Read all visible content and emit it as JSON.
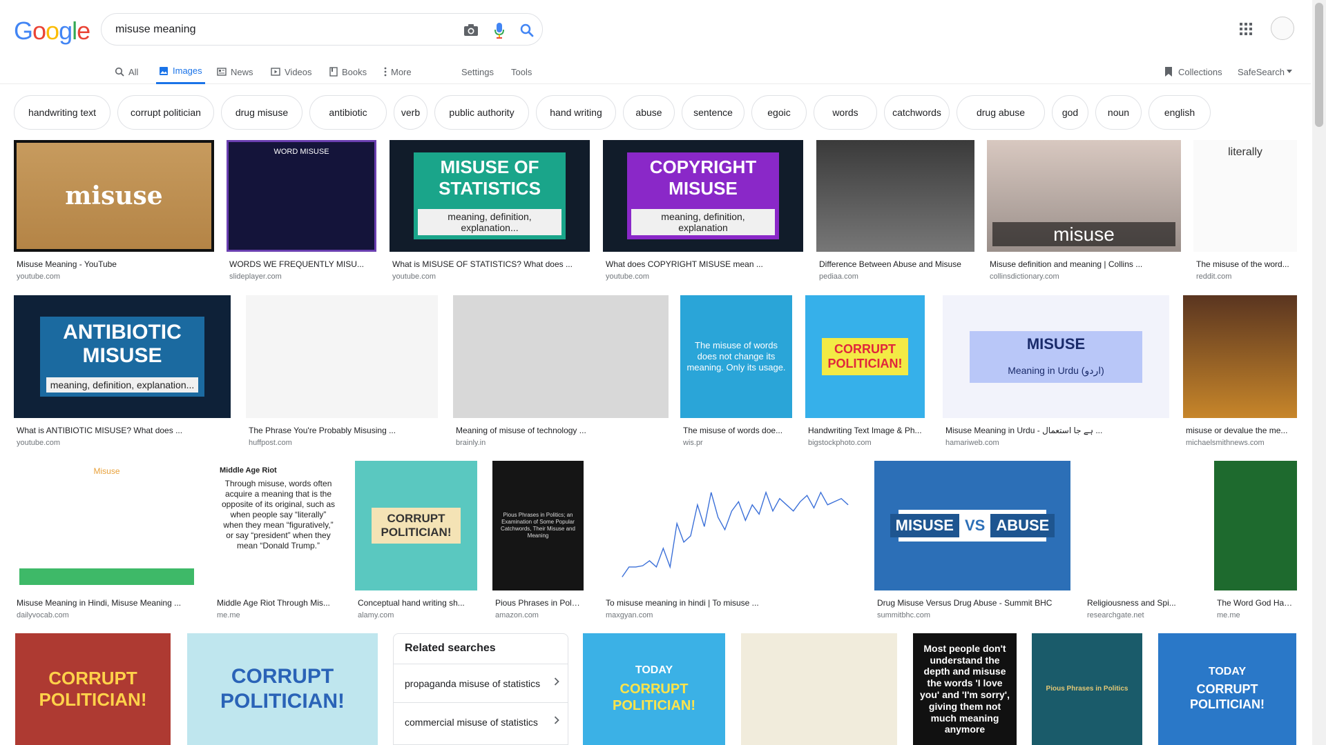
{
  "logo": "Google",
  "search": {
    "query": "misuse meaning"
  },
  "nav": {
    "all": "All",
    "images": "Images",
    "news": "News",
    "videos": "Videos",
    "books": "Books",
    "more": "More",
    "settings": "Settings",
    "tools": "Tools",
    "collections": "Collections",
    "safesearch": "SafeSearch"
  },
  "chips": [
    "handwriting text",
    "corrupt politician",
    "drug misuse",
    "antibiotic",
    "verb",
    "public authority",
    "hand writing",
    "abuse",
    "sentence",
    "egoic",
    "words",
    "catchwords",
    "drug abuse",
    "god",
    "noun",
    "english"
  ],
  "results": [
    {
      "caption": "Misuse Meaning - YouTube",
      "source": "youtube.com",
      "thumb_text": "misuse"
    },
    {
      "caption": "WORDS WE FREQUENTLY MISU...",
      "source": "slideplayer.com",
      "thumb_text": "WORD MISUSE"
    },
    {
      "caption": "What is MISUSE OF STATISTICS? What does ...",
      "source": "youtube.com",
      "thumb_text": "MISUSE OF STATISTICS",
      "thumb_sub": "meaning, definition, explanation..."
    },
    {
      "caption": "What does COPYRIGHT MISUSE mean ...",
      "source": "youtube.com",
      "thumb_text": "COPYRIGHT MISUSE",
      "thumb_sub": "meaning, definition, explanation"
    },
    {
      "caption": "Difference Between Abuse and Misuse",
      "source": "pediaa.com"
    },
    {
      "caption": "Misuse definition and meaning | Collins ...",
      "source": "collinsdictionary.com",
      "thumb_text": "misuse"
    },
    {
      "caption": "The misuse of the word...",
      "source": "reddit.com",
      "thumb_text": "literally"
    },
    {
      "caption": "What is ANTIBIOTIC MISUSE? What does ...",
      "source": "youtube.com",
      "thumb_text": "ANTIBIOTIC MISUSE",
      "thumb_sub": "meaning, definition, explanation..."
    },
    {
      "caption": "The Phrase You're Probably Misusing ...",
      "source": "huffpost.com"
    },
    {
      "caption": "Meaning of misuse of technology ...",
      "source": "brainly.in"
    },
    {
      "caption": "The misuse of words doe...",
      "source": "wis.pr",
      "thumb_text": "The misuse of words does not change its meaning. Only its usage."
    },
    {
      "caption": "Handwriting Text Image & Ph...",
      "source": "bigstockphoto.com",
      "thumb_text": "CORRUPT POLITICIAN!"
    },
    {
      "caption": "Misuse Meaning in Urdu - ہے جا استعمال ...",
      "source": "hamariweb.com",
      "thumb_text": "MISUSE",
      "thumb_sub": "Meaning in Urdu (اردو)"
    },
    {
      "caption": "misuse or devalue the me...",
      "source": "michaelsmithnews.com"
    },
    {
      "caption": "Misuse Meaning in Hindi, Misuse Meaning ...",
      "source": "dailyvocab.com",
      "thumb_text": "Misuse"
    },
    {
      "caption": "Middle Age Riot Through Mis...",
      "source": "me.me",
      "thumb_text": "Through misuse, words often acquire a meaning that is the opposite of its original, such as when people say “literally” when they mean “figuratively,” or say “president” when they mean “Donald Trump.”",
      "thumb_sub": "Middle Age Riot"
    },
    {
      "caption": "Conceptual hand writing sh...",
      "source": "alamy.com",
      "thumb_text": "CORRUPT POLITICIAN!"
    },
    {
      "caption": "Pious Phrases in Politi...",
      "source": "amazon.com",
      "thumb_text": "Pious Phrases in Politics; an Examination of Some Popular Catchwords, Their Misuse and Meaning"
    },
    {
      "caption": "To misuse meaning in hindi | To misuse ...",
      "source": "maxgyan.com"
    },
    {
      "caption": "Drug Misuse Versus Drug Abuse - Summit BHC",
      "source": "summitbhc.com",
      "thumb_text": "MISUSE",
      "thumb_mid": "VS",
      "thumb_sub": "ABUSE"
    },
    {
      "caption": "Religiousness and Spi...",
      "source": "researchgate.net"
    },
    {
      "caption": "The Word God Has Be...",
      "source": "me.me"
    }
  ],
  "row4": [
    {
      "thumb_text": "CORRUPT POLITICIAN!"
    },
    {
      "thumb_text": "CORRUPT POLITICIAN!"
    },
    {
      "thumb_text": "CORRUPT POLITICIAN!",
      "thumb_sub": "TODAY"
    },
    {},
    {
      "thumb_text": "Most people don't understand the depth and misuse the words 'I love you' and 'I'm sorry', giving them not much meaning anymore"
    },
    {
      "thumb_text": "Pious Phrases in Politics"
    },
    {
      "thumb_text": "CORRUPT POLITICIAN!",
      "thumb_sub": "TODAY"
    }
  ],
  "related": {
    "title": "Related searches",
    "items": [
      "propaganda misuse of statistics",
      "commercial misuse of statistics"
    ]
  },
  "colors": {
    "accent": "#1a73e8",
    "google_blue": "#4285f4",
    "google_red": "#ea4335",
    "google_yellow": "#fbbc05",
    "google_green": "#34a853"
  }
}
